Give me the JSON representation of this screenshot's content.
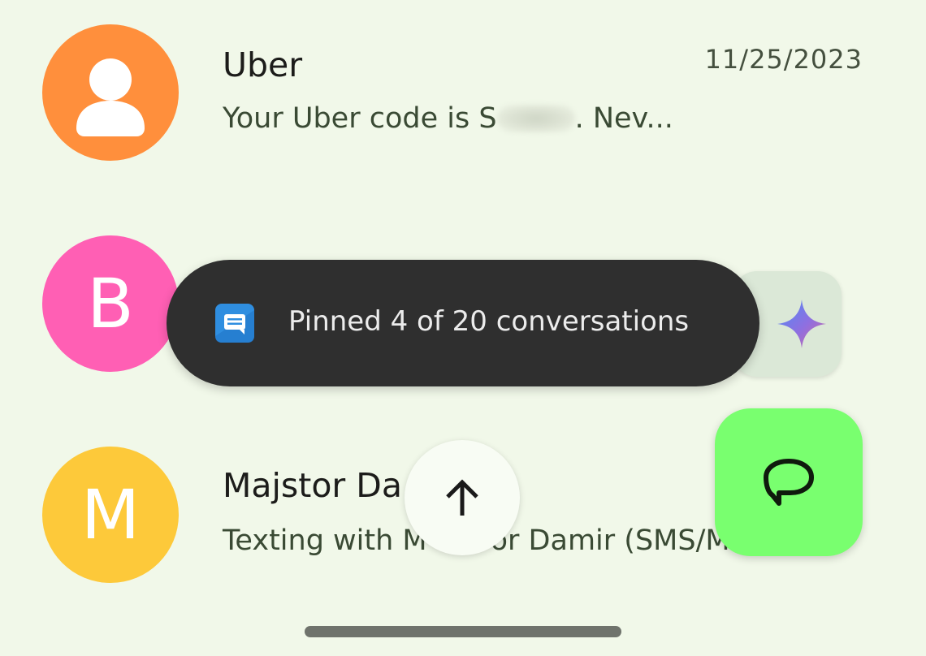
{
  "conversations": [
    {
      "name": "Uber",
      "snippet_before": "Your Uber code is S",
      "snippet_after": ". Nev...",
      "timestamp": "11/25/2023",
      "avatar_icon": "person-icon",
      "avatar_color": "#ff8f3c"
    },
    {
      "avatar_letter": "B",
      "avatar_color": "#ff5fb4"
    },
    {
      "name": "Majstor Da",
      "snippet": "Texting with M",
      "snippet_tail": "or Damir (SMS/M",
      "avatar_letter": "M",
      "avatar_color": "#fdc93a"
    }
  ],
  "toast": {
    "message": "Pinned 4 of 20 conversations",
    "icon": "messages-app-icon"
  },
  "gemini_button": {
    "icon": "gemini-sparkle-icon"
  },
  "scroll_to_top": {
    "icon": "arrow-up-icon"
  },
  "compose_fab": {
    "icon": "chat-bubble-icon",
    "color": "#79ff6f"
  }
}
